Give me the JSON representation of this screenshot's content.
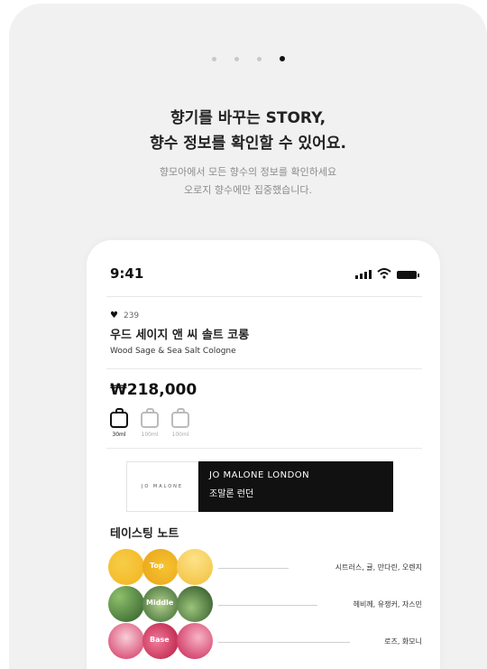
{
  "intro": {
    "headline_line1": "향기를 바꾸는 STORY,",
    "headline_line2": "향수 정보를 확인할 수 있어요.",
    "sub_line1": "향모아에서 모든 향수의 정보를 확인하세요",
    "sub_line2": "오로지 향수에만 집중했습니다.",
    "page_count": 4,
    "active_page": 4
  },
  "phone": {
    "status": {
      "time": "9:41"
    },
    "product": {
      "likes": "239",
      "name_ko": "우드 세이지 앤 씨 솔트 코롱",
      "name_en": "Wood Sage & Sea Salt Cologne",
      "price": "₩218,000",
      "sizes": [
        {
          "label": "30ml",
          "selected": true
        },
        {
          "label": "100ml",
          "selected": false
        },
        {
          "label": "100ml",
          "selected": false
        }
      ]
    },
    "brand": {
      "logo_text": "JO MALONE",
      "name_en": "JO MALONE LONDON",
      "name_ko": "조말론 런던"
    },
    "notes": {
      "title": "테이스팅 노트",
      "rows": [
        {
          "badge": "Top",
          "text": "시트러스, 귤, 만다린, 오렌지"
        },
        {
          "badge": "Middle",
          "text": "헤비께, 유쟁커, 자스민"
        },
        {
          "badge": "Base",
          "text": "로즈, 화모니"
        }
      ]
    }
  },
  "colors": {
    "background": "#f1f1f1",
    "brand_dark": "#111111",
    "top_note": "#f3b31d",
    "middle_note": "#2f5c2a",
    "base_note": "#d3315f"
  }
}
